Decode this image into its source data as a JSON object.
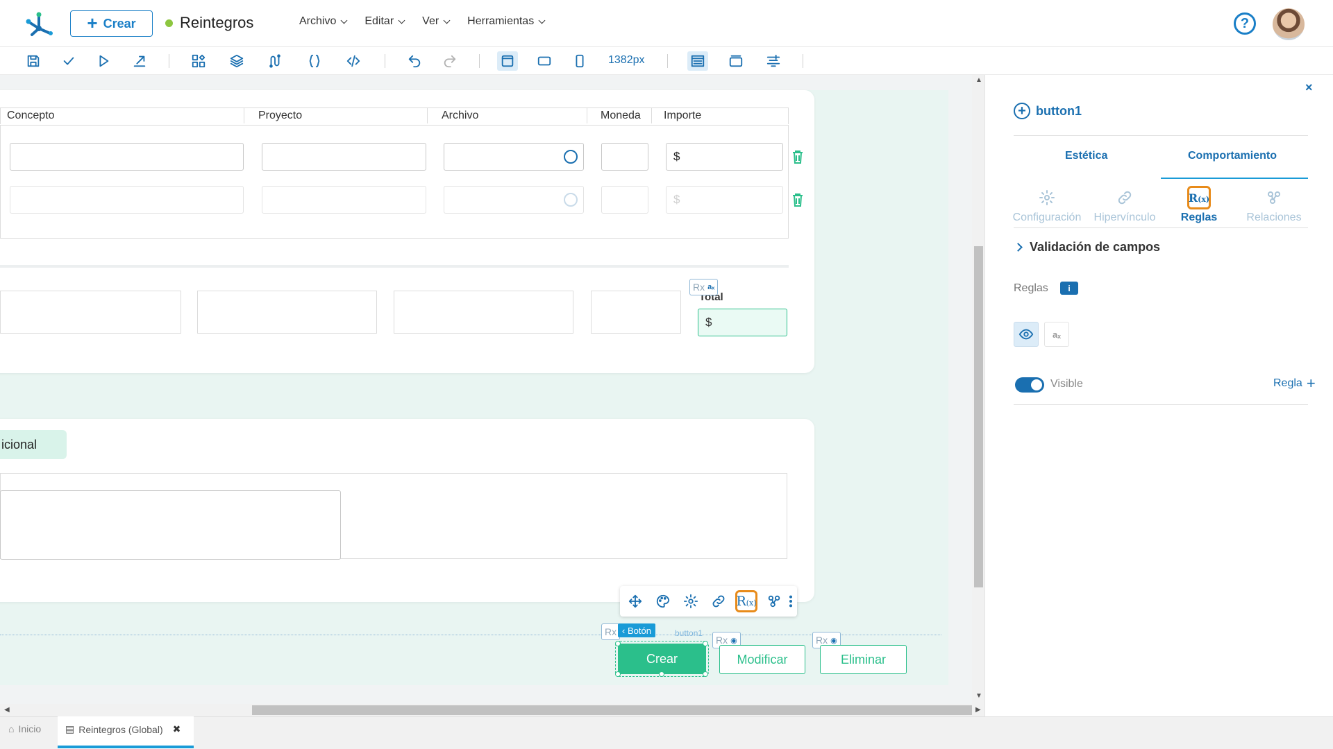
{
  "header": {
    "create_label": "Crear",
    "app_title": "Reintegros",
    "menus": [
      "Archivo",
      "Editar",
      "Ver",
      "Herramientas"
    ],
    "help_label": "?"
  },
  "toolbar": {
    "width_readout": "1382px"
  },
  "grid": {
    "columns": [
      "Concepto",
      "Proyecto",
      "Archivo",
      "Moneda",
      "Importe"
    ],
    "currency_symbol": "$"
  },
  "totals": {
    "label": "Total",
    "value": "$"
  },
  "form": {
    "section_label": "icional"
  },
  "chips": {
    "rx": "Rx",
    "ax": "aₓ"
  },
  "buttons": {
    "crear": "Crear",
    "modificar": "Modificar",
    "eliminar": "Eliminar",
    "tag_boton": "Botón",
    "tag_name": "button1"
  },
  "panel": {
    "close": "×",
    "title": "button1",
    "tabs": [
      "Estética",
      "Comportamiento"
    ],
    "subtabs": [
      "Configuración",
      "Hipervínculo",
      "Reglas",
      "Relaciones"
    ],
    "section": "Validación de campos",
    "reglas_label": "Reglas",
    "info": "i",
    "toggle_label": "Visible",
    "add_rule": "Regla"
  },
  "bottom_tabs": [
    {
      "label": "Inicio"
    },
    {
      "label": "Reintegros (Global)"
    }
  ],
  "colors": {
    "brand_blue": "#1a6fb0",
    "accent_green": "#2bbf8b",
    "selection_orange": "#e88b1a"
  }
}
